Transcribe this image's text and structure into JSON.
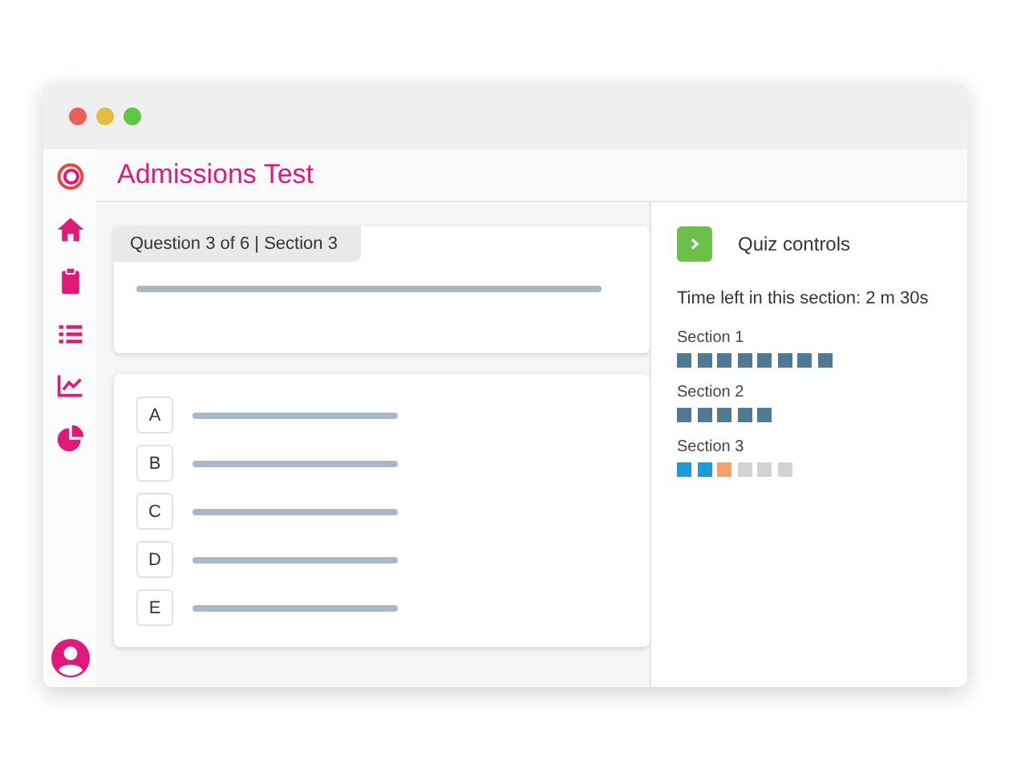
{
  "window": {
    "title": "Admissions Test"
  },
  "question": {
    "tab": "Question 3 of 6 | Section 3"
  },
  "options": [
    {
      "letter": "A"
    },
    {
      "letter": "B"
    },
    {
      "letter": "C"
    },
    {
      "letter": "D"
    },
    {
      "letter": "E"
    }
  ],
  "quiz_controls": {
    "title": "Quiz controls",
    "time_left": "Time left in this section: 2 m 30s",
    "sections": [
      {
        "label": "Section 1",
        "questions": [
          {
            "kind": "done"
          },
          {
            "kind": "done"
          },
          {
            "kind": "done"
          },
          {
            "kind": "done"
          },
          {
            "kind": "done"
          },
          {
            "kind": "done"
          },
          {
            "kind": "done"
          },
          {
            "kind": "done"
          }
        ]
      },
      {
        "label": "Section 2",
        "questions": [
          {
            "kind": "done"
          },
          {
            "kind": "done"
          },
          {
            "kind": "done"
          },
          {
            "kind": "done"
          },
          {
            "kind": "done"
          }
        ]
      },
      {
        "label": "Section 3",
        "questions": [
          {
            "kind": "answered"
          },
          {
            "kind": "answered"
          },
          {
            "kind": "current"
          },
          {
            "kind": "pending"
          },
          {
            "kind": "pending"
          },
          {
            "kind": "pending"
          }
        ]
      }
    ]
  }
}
